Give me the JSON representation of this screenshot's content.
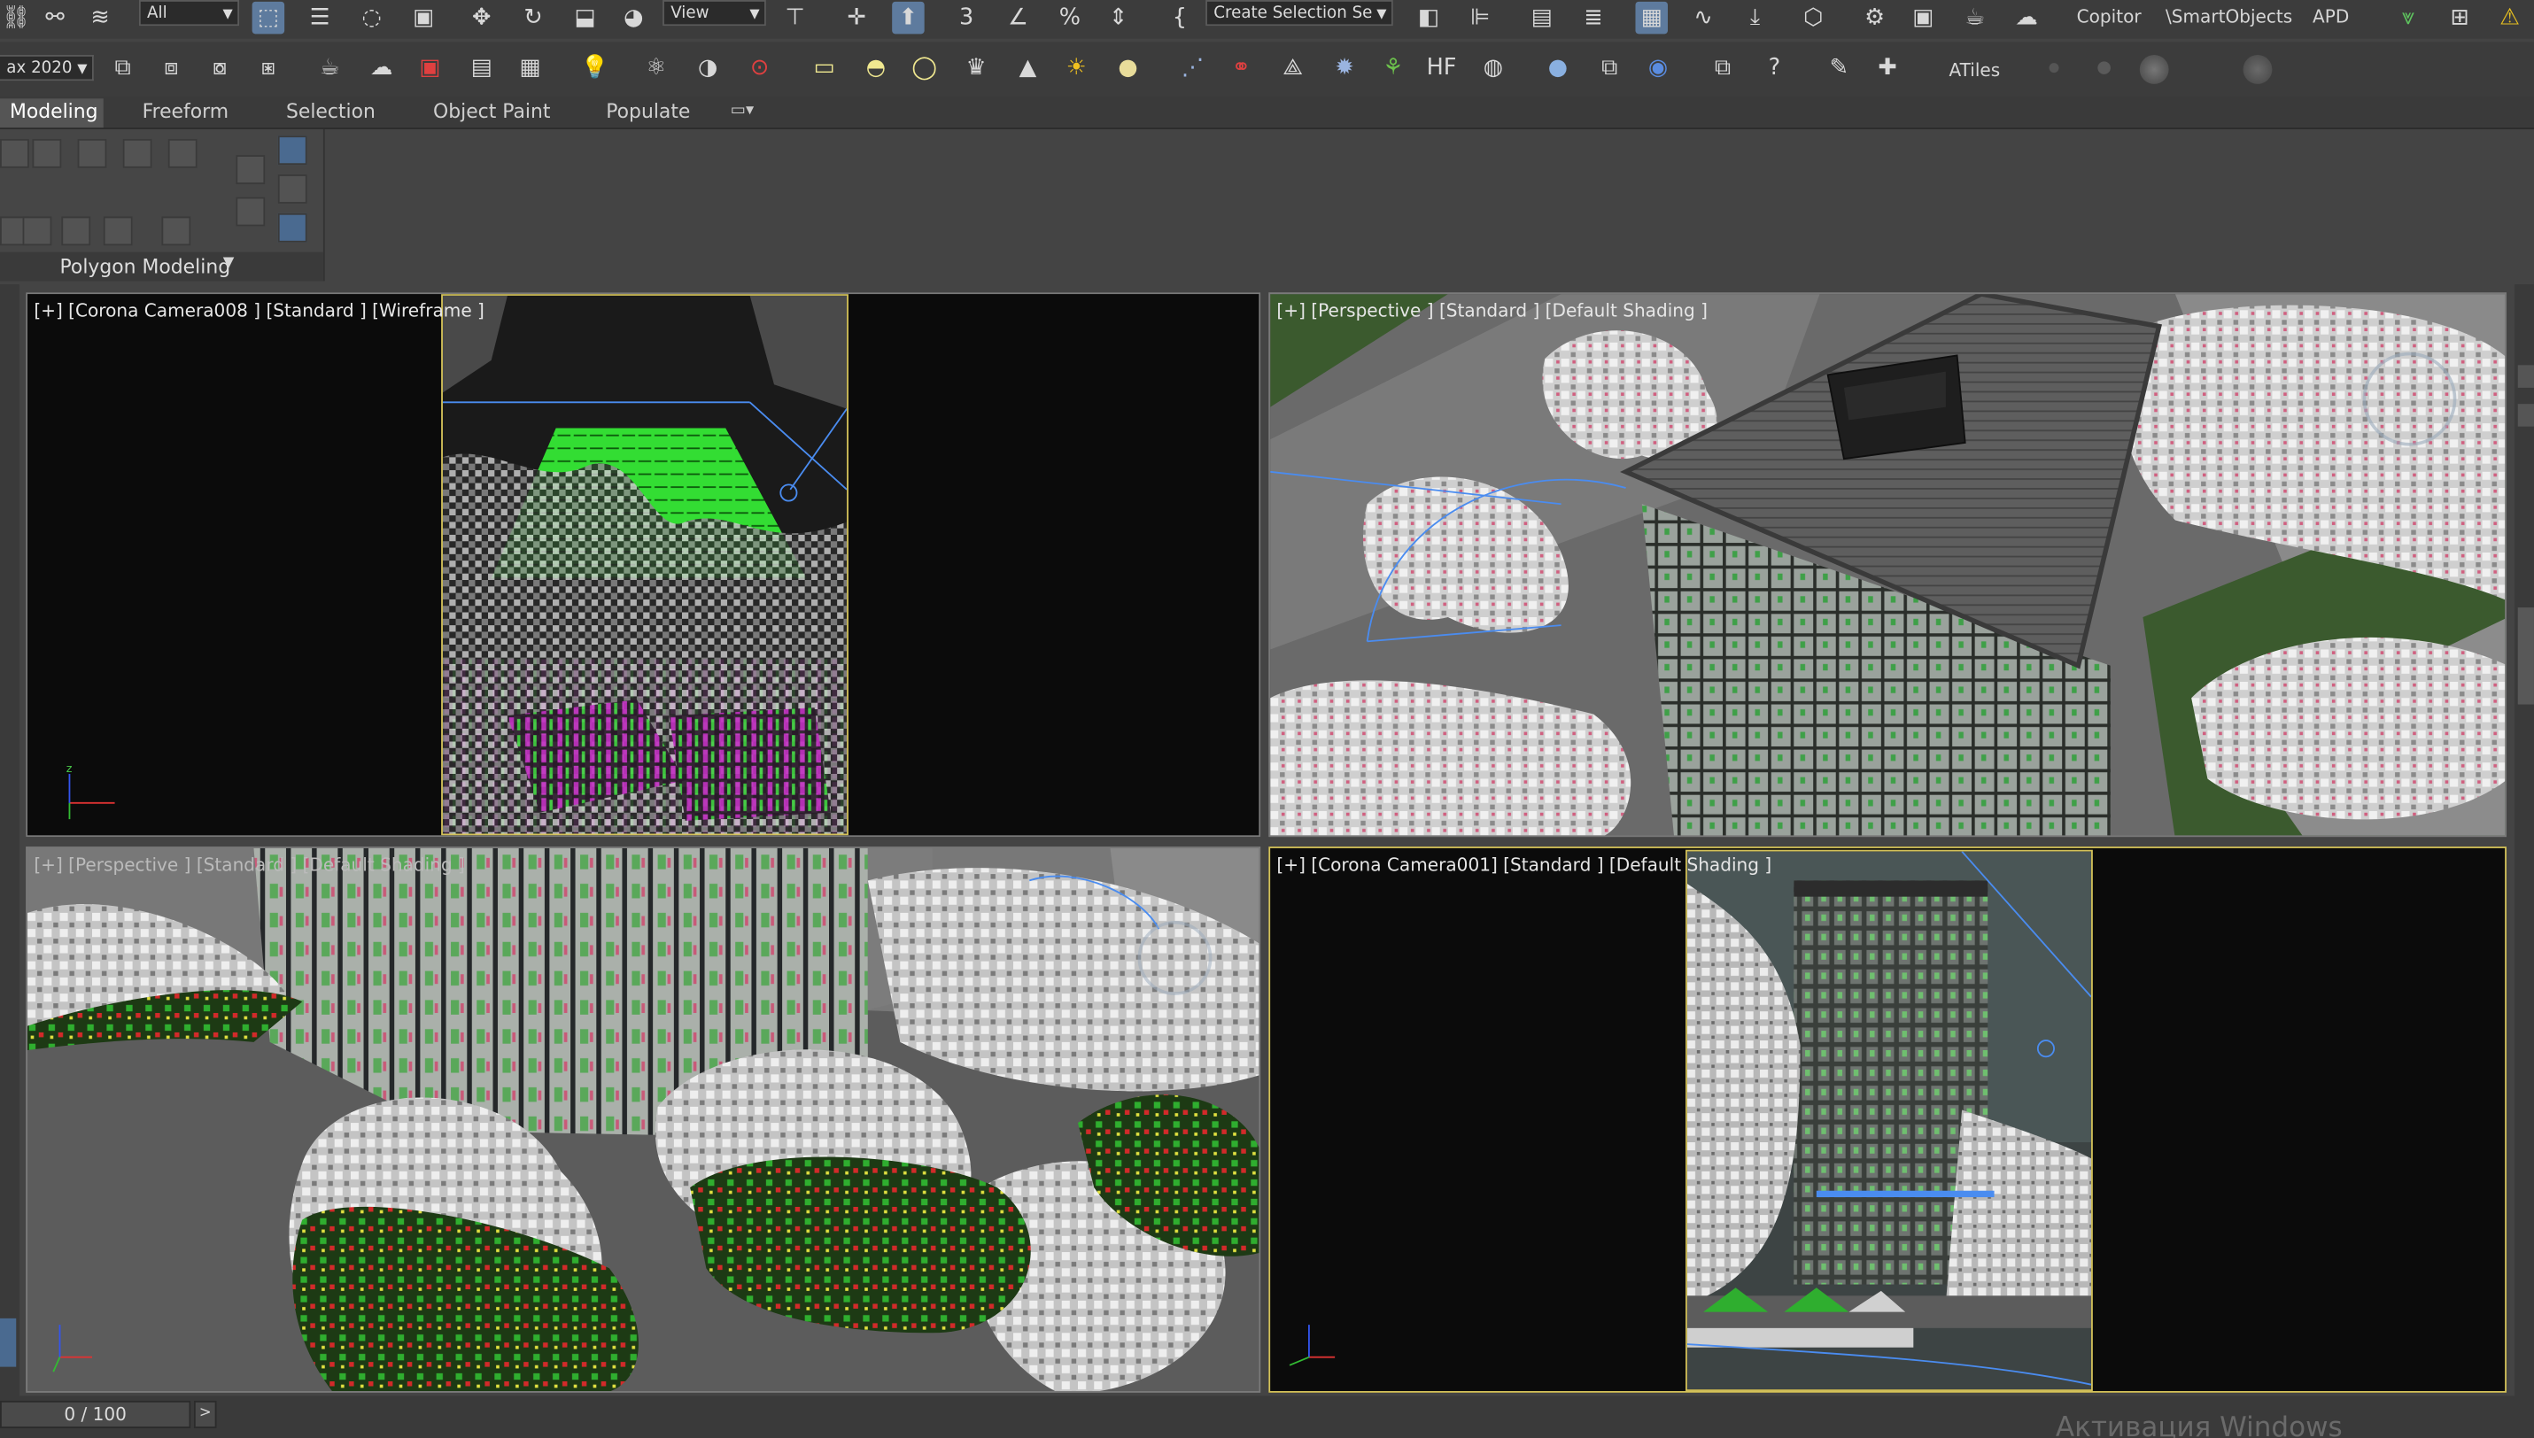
{
  "toolbar_top": {
    "selection_filter": "All",
    "ref_coord": "View",
    "named_selection": "Create Selection Se",
    "items": [
      "Copitor",
      "\\SmartObjects",
      "APD"
    ]
  },
  "toolbar_second": {
    "workspace": "ax 2020",
    "atiles": "ATiles"
  },
  "ribbon": {
    "tabs": [
      "Modeling",
      "Freeform",
      "Selection",
      "Object Paint",
      "Populate"
    ],
    "active_tab": "Modeling",
    "panel_label": "Polygon Modeling"
  },
  "viewports": {
    "top_left": "[+] [Corona Camera008 ] [Standard ] [Wireframe ]",
    "top_right": "[+] [Perspective ] [Standard ] [Default Shading ]",
    "bottom_left": "[+] [Perspective ] [Standard ] [Default Shading ]",
    "bottom_right": "[+] [Corona Camera001] [Standard ] [Default Shading ]"
  },
  "timeline": {
    "frame": "0 / 100"
  },
  "watermark": "Активация Windows",
  "colors": {
    "accent": "#5e7b9e",
    "viewport_border_active": "#d4c25a",
    "bg": "#444444"
  }
}
